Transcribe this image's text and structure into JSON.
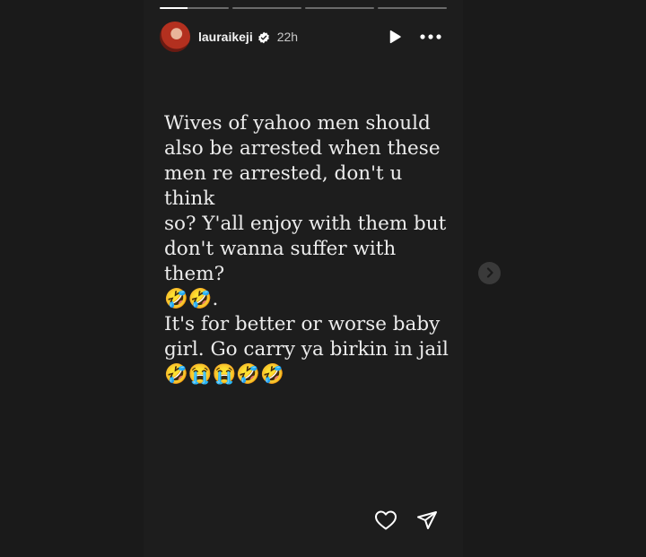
{
  "story": {
    "progress": [
      {
        "filled": 0.4
      },
      {
        "filled": 0
      },
      {
        "filled": 0
      },
      {
        "filled": 0
      }
    ],
    "header": {
      "username": "lauraikeji",
      "timestamp": "22h"
    },
    "text": "Wives of yahoo men should\nalso be arrested when these\nmen re arrested, don't u think\nso? Y'all enjoy with them but\ndon't wanna suffer with them?\n🤣🤣.\nIt's for better or worse baby\ngirl. Go carry ya birkin in jail\n🤣😭😭🤣🤣"
  },
  "icons": {
    "verified": "verified-badge-icon",
    "play": "play-icon",
    "more": "more-options-icon",
    "like": "heart-icon",
    "share": "paper-plane-icon",
    "next": "chevron-right-icon"
  },
  "colors": {
    "page_background": "#1a1a1a",
    "story_background": "#1d1d1d",
    "text": "#ececec",
    "next_button": "#3a3a3a"
  }
}
